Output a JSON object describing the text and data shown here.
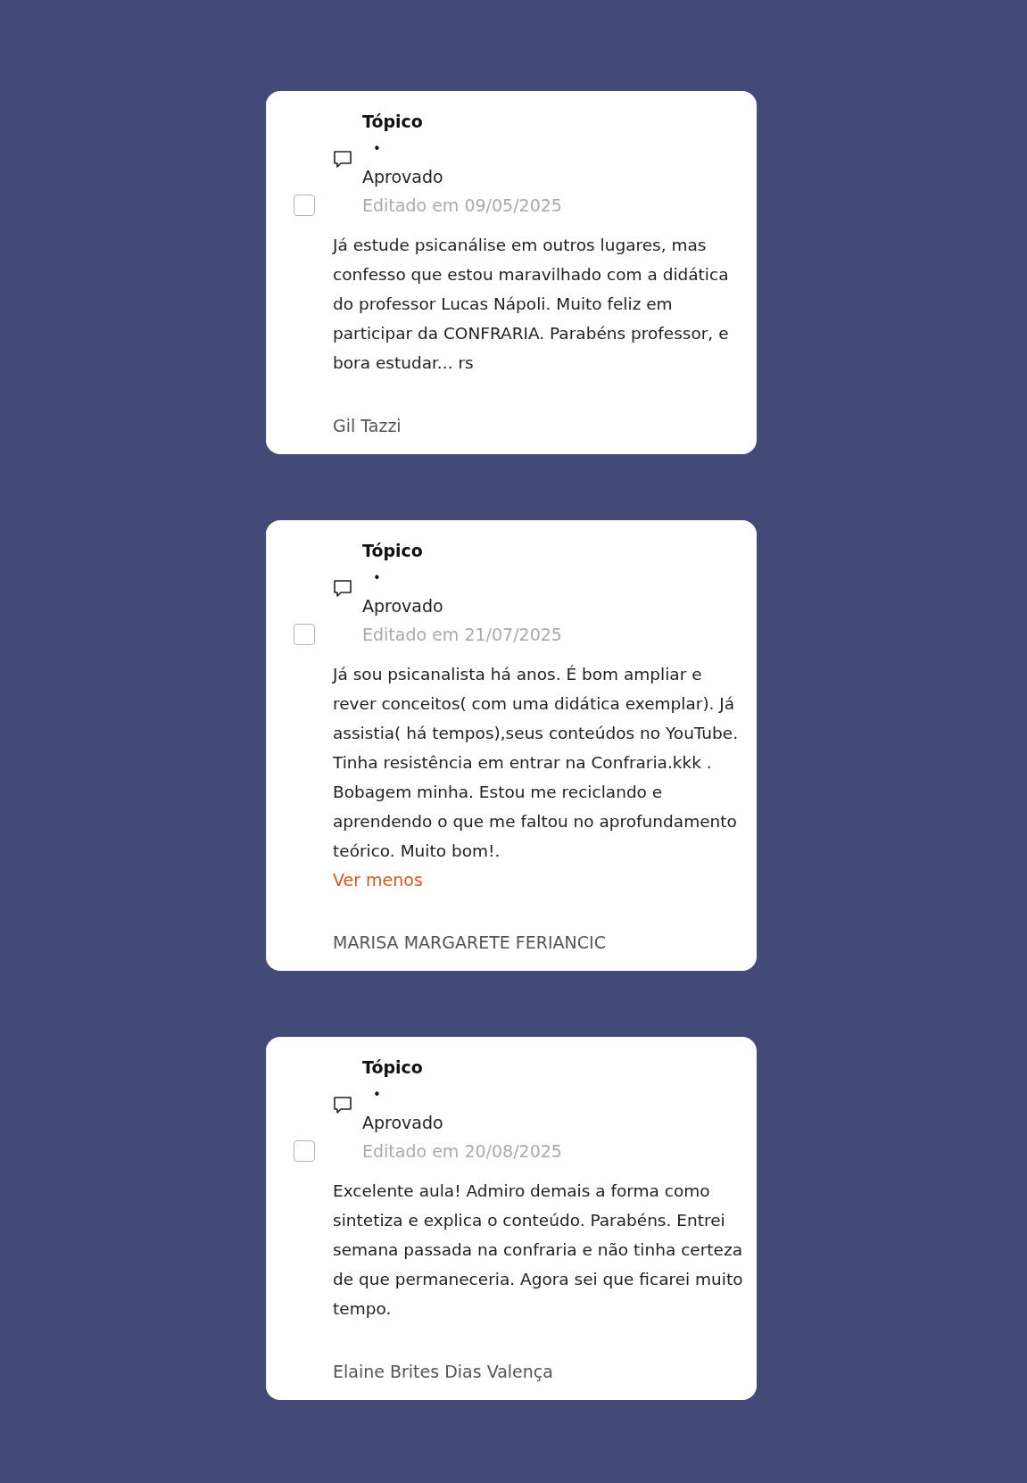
{
  "comments": [
    {
      "checked": false,
      "title": "Tópico",
      "bullet": "•",
      "status": "Aprovado",
      "edited": "Editado em 09/05/2025",
      "body": "Já estude psicanálise em outros lugares, mas confesso que estou maravilhado com a didática do professor Lucas Nápoli. Muito feliz em participar da CONFRARIA. Parabéns professor, e bora estudar... rs",
      "author": "Gil Tazzi"
    },
    {
      "checked": false,
      "title": "Tópico",
      "bullet": "•",
      "status": "Aprovado",
      "edited": "Editado em 21/07/2025",
      "body": "Já sou psicanalista há anos. É bom ampliar e rever conceitos( com uma didática exemplar). Já assistia( há tempos),seus conteúdos no YouTube. Tinha resistência em entrar na Confraria.kkk . Bobagem minha. Estou me reciclando e aprendendo o que me faltou no aprofundamento teórico. Muito bom!.",
      "toggle_link": "Ver menos",
      "author": "MARISA MARGARETE FERIANCIC"
    },
    {
      "checked": false,
      "title": "Tópico",
      "bullet": "•",
      "status": "Aprovado",
      "edited": "Editado em 20/08/2025",
      "body": "Excelente aula! Admiro demais a forma como sintetiza e explica o conteúdo. Parabéns. Entrei semana passada na confraria e não tinha certeza de que permaneceria. Agora sei que ficarei muito tempo.",
      "author": "Elaine Brites Dias Valença"
    }
  ]
}
